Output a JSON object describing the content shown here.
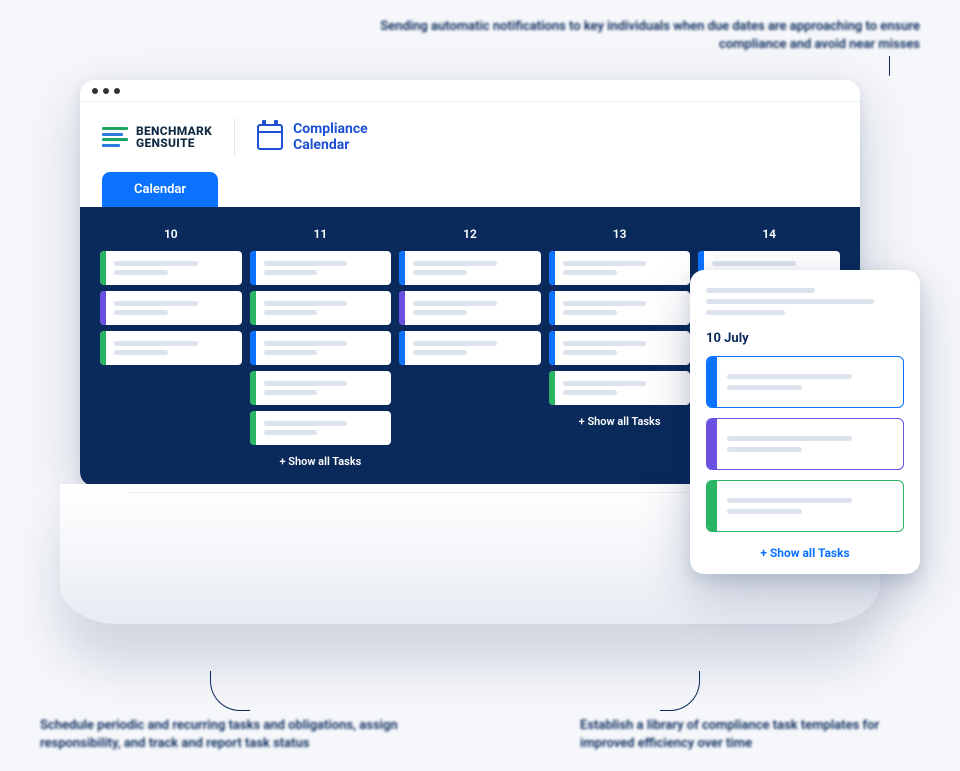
{
  "annotations": {
    "top": "Sending automatic notifications to key individuals when due dates are approaching to ensure compliance and avoid near misses",
    "bottomLeft": "Schedule periodic and recurring tasks and obligations, assign responsibility, and track and report task status",
    "bottomRight": "Establish a library of compliance task templates for improved efficiency over time"
  },
  "brand": {
    "line1": "BENCHMARK",
    "line2": "GENSUITE"
  },
  "appTitle": {
    "line1": "Compliance",
    "line2": "Calendar"
  },
  "tabs": {
    "calendar": "Calendar"
  },
  "calendar": {
    "days": [
      "10",
      "11",
      "12",
      "13",
      "14"
    ],
    "showAll": "+ Show all Tasks",
    "columns": [
      {
        "cards": [
          "green",
          "purple",
          "green"
        ],
        "showAll": false
      },
      {
        "cards": [
          "blue",
          "green",
          "blue",
          "green",
          "green"
        ],
        "showAll": true
      },
      {
        "cards": [
          "blue",
          "purple",
          "blue"
        ],
        "showAll": false
      },
      {
        "cards": [
          "blue",
          "blue",
          "blue",
          "green"
        ],
        "showAll": true
      },
      {
        "cards": [
          "blue",
          "blue"
        ],
        "showAll": false
      }
    ]
  },
  "sidePanel": {
    "date": "10 July",
    "cards": [
      "blue",
      "purple",
      "green"
    ],
    "showAll": "+ Show all Tasks"
  }
}
